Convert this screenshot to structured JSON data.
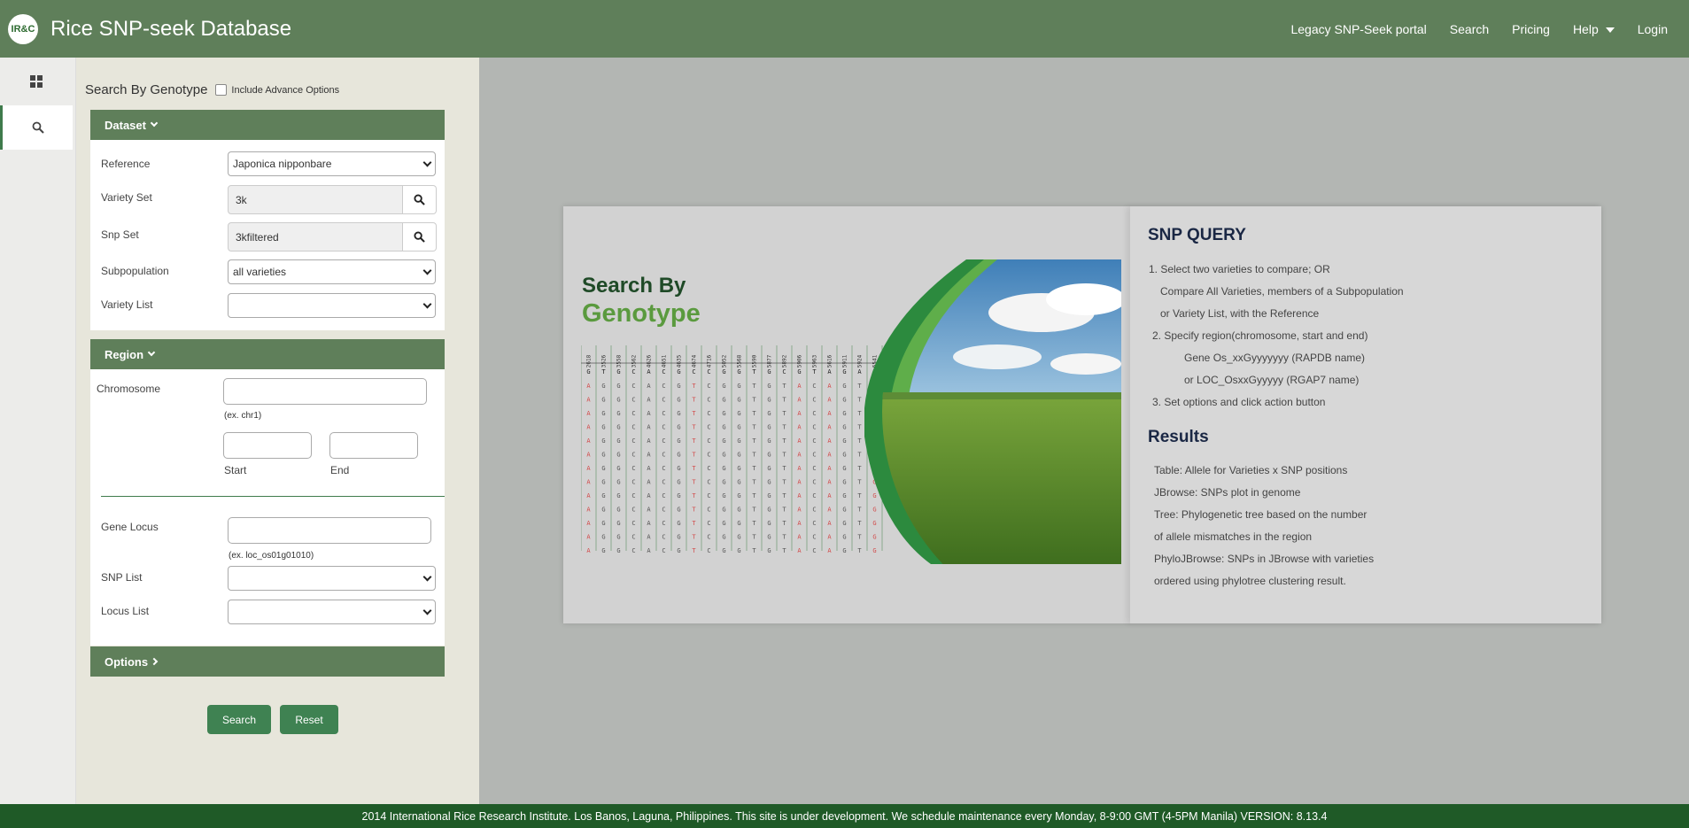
{
  "header": {
    "logo_text": "IR&C",
    "title": "Rice SNP-seek Database",
    "nav": [
      "Legacy SNP-Seek portal",
      "Search",
      "Pricing",
      "Help",
      "Login"
    ]
  },
  "panel": {
    "title": "Search By Genotype",
    "advance_label": "Include Advance Options",
    "dataset": {
      "header": "Dataset",
      "reference_label": "Reference",
      "reference_value": "Japonica nipponbare",
      "variety_set_label": "Variety Set",
      "variety_set_value": "3k",
      "snp_set_label": "Snp Set",
      "snp_set_value": "3kfiltered",
      "subpopulation_label": "Subpopulation",
      "subpopulation_value": "all varieties",
      "variety_list_label": "Variety List",
      "variety_list_value": ""
    },
    "region": {
      "header": "Region",
      "chromosome_label": "Chromosome",
      "chromosome_hint": "(ex. chr1)",
      "start_label": "Start",
      "end_label": "End",
      "gene_locus_label": "Gene Locus",
      "gene_locus_hint": "(ex. loc_os01g01010)",
      "snp_list_label": "SNP List",
      "locus_list_label": "Locus List"
    },
    "options_header": "Options",
    "search_button": "Search",
    "reset_button": "Reset"
  },
  "info": {
    "hero_line1": "Search By",
    "hero_line2": "Genotype",
    "snp_title": "SNP QUERY",
    "snp_lines": [
      "1.  Select two varieties to compare; OR",
      "Compare All Varieties, members of a Subpopulation",
      "or Variety List, with the Reference",
      "2. Specify region(chromosome, start and end)",
      "Gene Os_xxGyyyyyyy (RAPDB name)",
      "or LOC_OsxxGyyyyy (RGAP7 name)",
      "3. Set options and click action button"
    ],
    "results_title": "Results",
    "results_lines": [
      "Table: Allele for Varieties x SNP positions",
      "JBrowse: SNPs plot in genome",
      "Tree: Phylogenetic tree based on the number",
      "of allele mismatches in the region",
      "PhyloJBrowse: SNPs in JBrowse with varieties",
      "ordered using phylotree clustering result."
    ],
    "grid_headers": [
      "2618",
      "3526",
      "3558",
      "3562",
      "4626",
      "4651",
      "4635",
      "4674",
      "4716",
      "5052",
      "5568",
      "5590",
      "5877",
      "5892",
      "5906",
      "5963",
      "5616",
      "5911",
      "5924",
      "6541"
    ],
    "grid_ref": [
      "G",
      "T",
      "G",
      "C",
      "A",
      "C",
      "G",
      "C",
      "C",
      "G",
      "G",
      "T",
      "G",
      "C",
      "G",
      "T",
      "A",
      "G",
      "A",
      ""
    ],
    "grid_row": [
      "A",
      "G",
      "G",
      "C",
      "A",
      "C",
      "G",
      "T",
      "C",
      "G",
      "G",
      "T",
      "G",
      "T",
      "A",
      "C",
      "A",
      "G",
      "T",
      "G"
    ]
  },
  "footer": "2014 International Rice Research Institute. Los Banos, Laguna, Philippines. This site is under development. We schedule maintenance every Monday, 8-9:00 GMT (4-5PM Manila) VERSION: 8.13.4"
}
